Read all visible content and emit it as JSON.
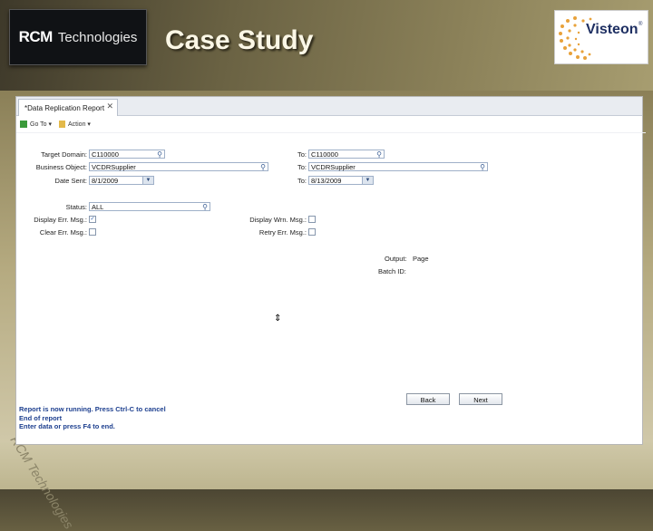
{
  "slide": {
    "title": "Case Study",
    "rcm_logo": {
      "brand": "RCM",
      "sub": "Technologies"
    },
    "visteon_logo": {
      "brand": "Visteon",
      "tm": "®"
    },
    "watermark": "RCM Technologies"
  },
  "app": {
    "tab": {
      "label": "*Data Replication Report",
      "close": "✕"
    },
    "toolbar": {
      "goto": "Go To ▾",
      "action": "Action ▾"
    },
    "form": {
      "target_domain": {
        "label": "Target Domain:",
        "value": "C110000",
        "to_label": "To:",
        "to_value": "C110000"
      },
      "business_object": {
        "label": "Business Object:",
        "value": "VCDRSupplier",
        "to_label": "To:",
        "to_value": "VCDRSupplier"
      },
      "date_sent": {
        "label": "Date Sent:",
        "value": "8/1/2009",
        "to_label": "To:",
        "to_value": "8/13/2009"
      },
      "status": {
        "label": "Status:",
        "value": "ALL"
      },
      "display_err": {
        "label": "Display Err. Msg.:",
        "checked": true
      },
      "clear_err": {
        "label": "Clear Err. Msg.:",
        "checked": false
      },
      "display_wrn": {
        "label": "Display Wrn. Msg.:",
        "checked": false
      },
      "retry_err": {
        "label": "Retry Err. Msg.:",
        "checked": false
      },
      "output": {
        "label": "Output:",
        "value": "Page"
      },
      "batch_id": {
        "label": "Batch ID:",
        "value": ""
      }
    },
    "buttons": {
      "back": "Back",
      "next": "Next"
    },
    "console": [
      "Report is now running.  Press Ctrl-C to cancel",
      "End of report",
      "Enter data or press F4 to end."
    ],
    "cursor_glyph": "⇕"
  },
  "colors": {
    "console_text": "#1d3f8f",
    "field_border": "#9fb0c8",
    "visteon_blue": "#1e2f62"
  }
}
